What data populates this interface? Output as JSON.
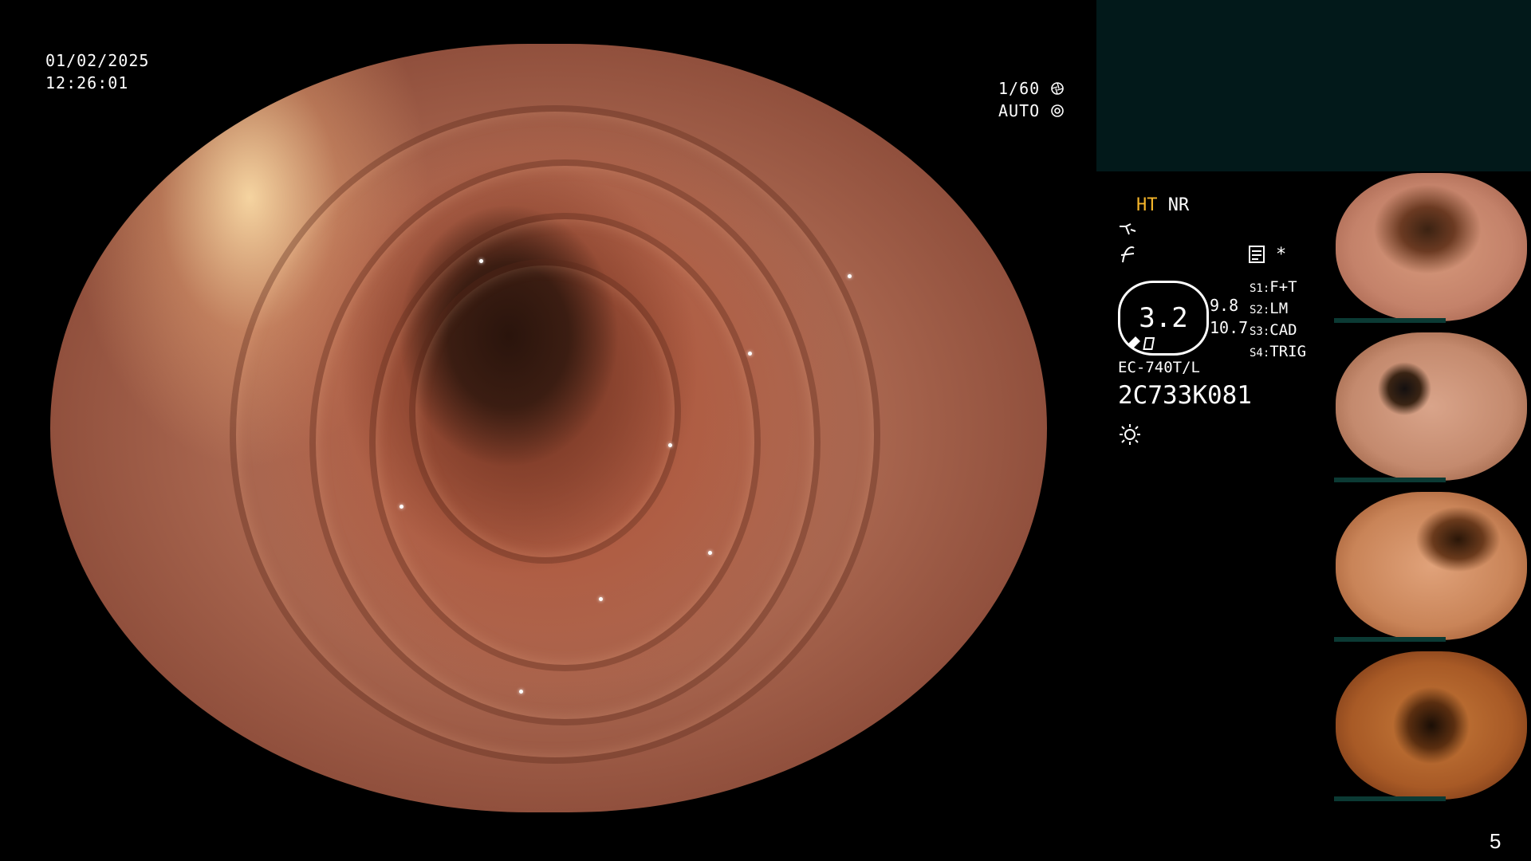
{
  "overlay": {
    "date": "01/02/2025",
    "time": "12:26:01",
    "shutter": "1/60",
    "iris": "AUTO"
  },
  "status_panel": {
    "ht_label": "HT",
    "nr_label": "NR",
    "star": "*",
    "scope_value": "3.2",
    "val_a": "9.8",
    "val_b": "10.7",
    "switches": [
      {
        "key": "S1:",
        "value": "F+T"
      },
      {
        "key": "S2:",
        "value": "LM"
      },
      {
        "key": "S3:",
        "value": "CAD"
      },
      {
        "key": "S4:",
        "value": "TRIG"
      }
    ],
    "scope_model": "EC-740T/L",
    "scope_serial": "2C733K081"
  },
  "page_number": "5",
  "colors": {
    "ht_accent": "#f5b52a",
    "top_box": "#02191a",
    "thumb_bar": "#0b3a34"
  },
  "icons": [
    "shutter-icon",
    "iris-icon",
    "enhance-icon",
    "color-icon",
    "record-icon",
    "light-icon"
  ]
}
